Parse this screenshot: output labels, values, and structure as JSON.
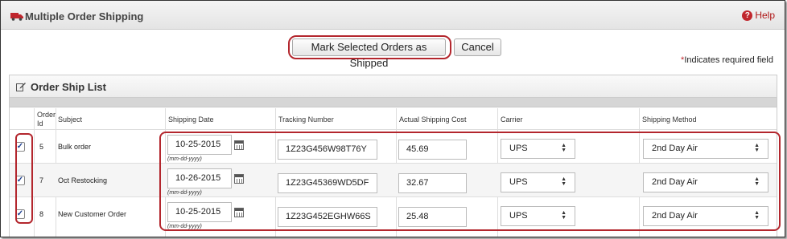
{
  "header": {
    "title": "Multiple Order Shipping",
    "help_label": "Help",
    "truck_icon": "truck-icon",
    "help_icon": "help-icon"
  },
  "actions": {
    "mark_shipped_label": "Mark Selected Orders as Shipped",
    "cancel_label": "Cancel"
  },
  "required_note": {
    "star": "*",
    "text": "Indicates required field"
  },
  "panel": {
    "title": "Order Ship List",
    "icon": "edit-icon"
  },
  "table": {
    "columns": {
      "order_id": "Order Id",
      "subject": "Subject",
      "shipping_date": "Shipping Date",
      "tracking_number": "Tracking Number",
      "actual_shipping_cost": "Actual Shipping Cost",
      "carrier": "Carrier",
      "shipping_method": "Shipping Method"
    },
    "date_format_hint": "(mm-dd-yyyy)",
    "rows": [
      {
        "checked": true,
        "order_id": "5",
        "subject": "Bulk order",
        "shipping_date": "10-25-2015",
        "tracking_number": "1Z23G456W98T76Y",
        "actual_shipping_cost": "45.69",
        "carrier": "UPS",
        "shipping_method": "2nd Day Air"
      },
      {
        "checked": true,
        "order_id": "7",
        "subject": "Oct Restocking",
        "shipping_date": "10-26-2015",
        "tracking_number": "1Z23G45369WD5DF",
        "actual_shipping_cost": "32.67",
        "carrier": "UPS",
        "shipping_method": "2nd Day Air"
      },
      {
        "checked": true,
        "order_id": "8",
        "subject": "New Customer Order",
        "shipping_date": "10-25-2015",
        "tracking_number": "1Z23G452EGHW66S",
        "actual_shipping_cost": "25.48",
        "carrier": "UPS",
        "shipping_method": "2nd Day Air"
      }
    ]
  },
  "colors": {
    "accent_red": "#b3262d",
    "header_bg": "#ececec"
  }
}
